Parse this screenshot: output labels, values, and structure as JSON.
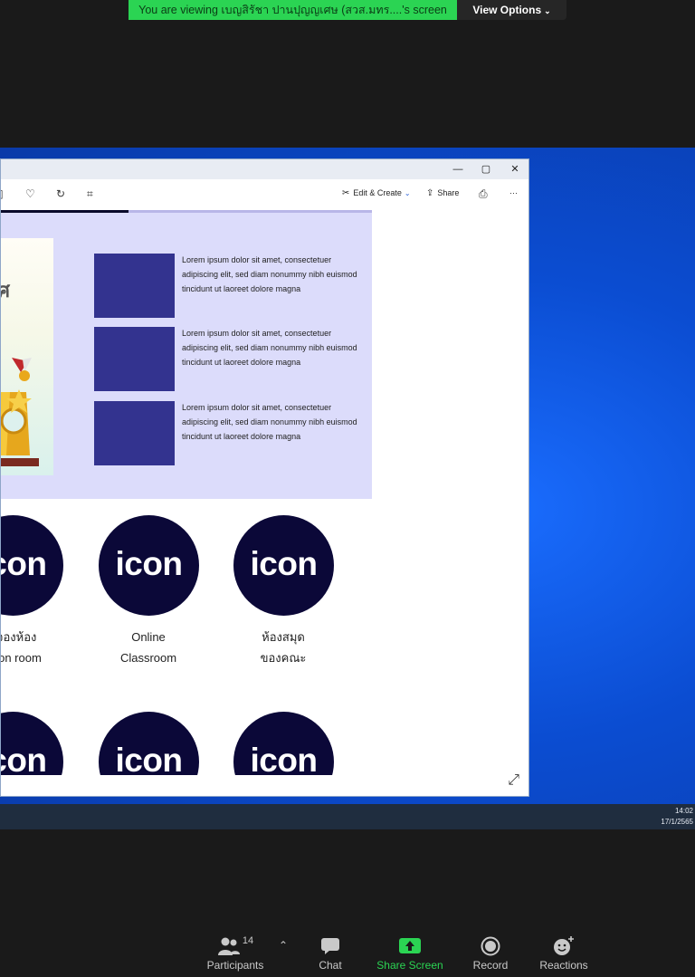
{
  "banner": {
    "text": "You are viewing เบญสิรัชา ปานปุญญเศษ (สวส.มทร....'s screen",
    "view_options_label": "View Options"
  },
  "photos_toolbar": {
    "edit_create_label": "Edit & Create",
    "share_label": "Share",
    "more_label": "···"
  },
  "slide": {
    "award_letter": "ศ",
    "items": [
      {
        "text": "Lorem ipsum dolor sit amet, consectetuer adipiscing elit, sed diam nonummy nibh euismod tincidunt ut laoreet dolore magna"
      },
      {
        "text": "Lorem ipsum dolor sit amet, consectetuer adipiscing elit, sed diam nonummy nibh euismod tincidunt ut laoreet dolore magna"
      },
      {
        "text": "Lorem ipsum dolor sit amet, consectetuer adipiscing elit, sed diam nonummy nibh euismod tincidunt ut laoreet dolore magna"
      }
    ]
  },
  "icon_grid": {
    "icon_text": "icon",
    "top_row": [
      {
        "line1": "บจองห้อง",
        "line2": "ssion room"
      },
      {
        "line1": "Online",
        "line2": "Classroom"
      },
      {
        "line1": "ห้องสมุด",
        "line2": "ของคณะ"
      }
    ]
  },
  "taskbar": {
    "time": "14:02",
    "date": "17/1/2565"
  },
  "zoom_bar": {
    "participants_label": "Participants",
    "participants_count": "14",
    "chat_label": "Chat",
    "share_label": "Share Screen",
    "record_label": "Record",
    "reactions_label": "Reactions"
  },
  "colors": {
    "banner_green": "#2bd453",
    "slide_bg": "#dcdcfb",
    "box_navy": "#33338f",
    "icon_navy": "#0b0838",
    "desktop_blue": "#0b4dd2"
  }
}
